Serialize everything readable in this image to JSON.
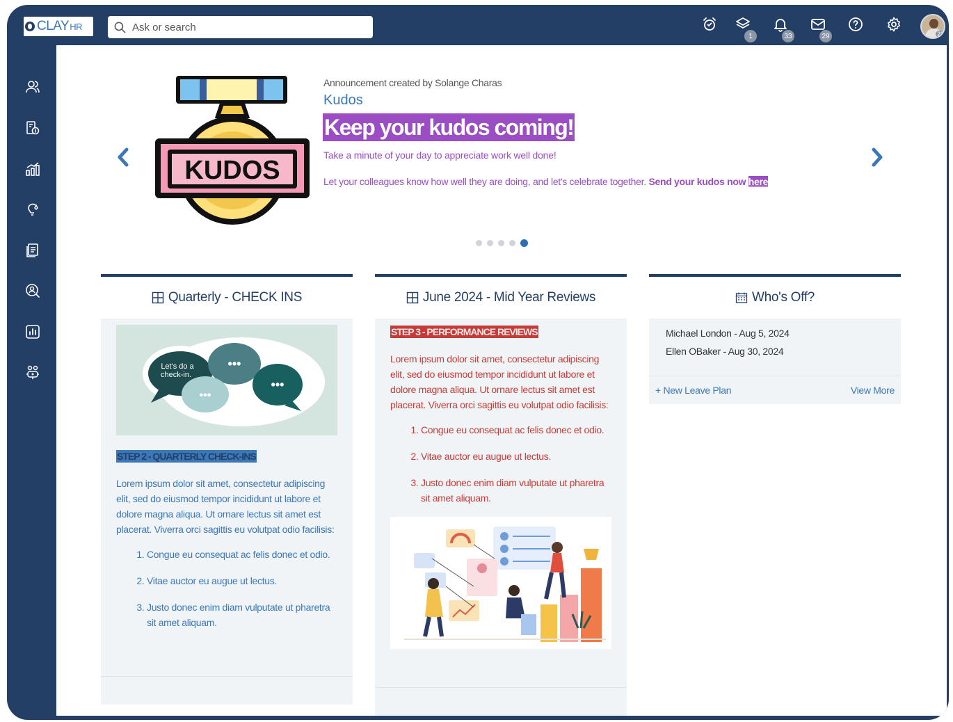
{
  "app": {
    "logo_text": "CLAY",
    "logo_suffix": "HR"
  },
  "search": {
    "placeholder": "Ask or search"
  },
  "topbar": {
    "icons": [
      "alarm-clock-icon",
      "layers-icon",
      "bell-icon",
      "mail-icon",
      "help-icon",
      "gear-icon"
    ],
    "badges": {
      "layers": "1",
      "bell": "33",
      "mail": "29",
      "avatar": "23"
    }
  },
  "sidebar": {
    "icons": [
      "people-icon",
      "payroll-icon",
      "analytics-icon",
      "ideas-icon",
      "documents-icon",
      "search-person-icon",
      "reports-icon",
      "org-chart-icon"
    ]
  },
  "announcement": {
    "image_text": "KUDOS",
    "meta": "Announcement created by Solange Charas",
    "title": "Kudos",
    "headline": "Keep your kudos coming!",
    "line1": "Take a minute of your day to appreciate work well done!",
    "line2_text": "Let your colleagues know how well they are doing, and let's celebrate together.",
    "line2_bold": "Send your kudos now",
    "line2_link": "here",
    "slides_total": 5,
    "slide_active": 5
  },
  "cards": {
    "checkins": {
      "title": "Quarterly - CHECK INS",
      "image_text": "Let's do a check-in.",
      "step_label": "STEP 2 - QUARTERLY CHECK-INS",
      "paragraph": "Lorem ipsum dolor sit amet, consectetur adipiscing elit, sed do eiusmod tempor incididunt ut labore et dolore magna aliqua. Ut ornare lectus sit amet est placerat. Viverra orci sagittis eu volutpat odio facilisis:",
      "list": [
        "Congue eu consequat ac felis donec et odio.",
        "Vitae auctor eu augue ut lectus.",
        "Justo donec enim diam vulputate ut pharetra sit amet aliquam."
      ]
    },
    "reviews": {
      "title": "June 2024 - Mid Year Reviews",
      "step_label": "STEP 3 - PERFORMANCE REVIEWS",
      "paragraph": "Lorem ipsum dolor sit amet, consectetur adipiscing elit, sed do eiusmod tempor incididunt ut labore et dolore magna aliqua. Ut ornare lectus sit amet est placerat. Viverra orci sagittis eu volutpat odio facilisis:",
      "list": [
        "Congue eu consequat ac felis donec et odio.",
        "Vitae auctor eu augue ut lectus.",
        "Justo donec enim diam vulputate ut pharetra sit amet aliquam."
      ]
    },
    "whos_off": {
      "title": "Who's Off?",
      "entries": [
        "Michael London - Aug 5, 2024",
        "Ellen OBaker - Aug 30, 2024"
      ],
      "new_leave": "+ New Leave Plan",
      "view_more": "View More"
    }
  },
  "colors": {
    "navy": "#233f66",
    "accent_blue": "#3b78b9",
    "purple": "#9b4dc4",
    "red": "#c63b37"
  }
}
